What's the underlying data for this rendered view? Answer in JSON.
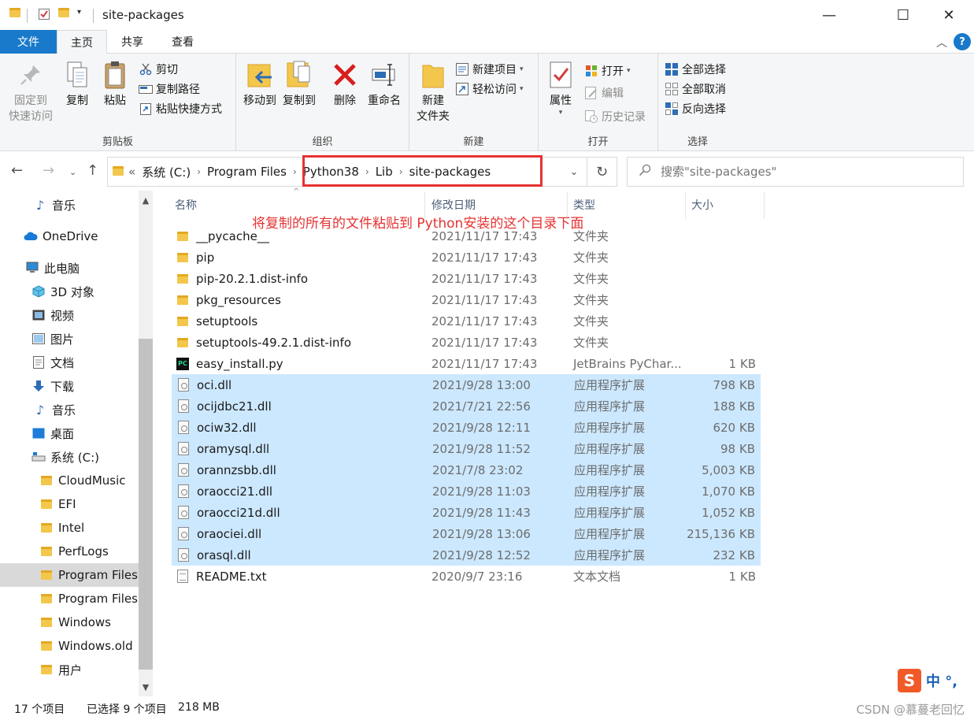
{
  "window": {
    "title": "site-packages",
    "minimize_glyph": "—",
    "maximize_glyph": "☐",
    "close_glyph": "✕"
  },
  "ribbon_tabs": [
    "文件",
    "主页",
    "共享",
    "查看"
  ],
  "ribbon": {
    "clipboard": {
      "group_label": "剪贴板",
      "pin_label_1": "固定到",
      "pin_label_2": "快速访问",
      "copy": "复制",
      "paste": "粘贴",
      "cut": "剪切",
      "copy_path": "复制路径",
      "paste_shortcut": "粘贴快捷方式"
    },
    "organize": {
      "group_label": "组织",
      "move_to": "移动到",
      "copy_to": "复制到",
      "delete": "删除",
      "rename": "重命名"
    },
    "new": {
      "group_label": "新建",
      "new_folder_1": "新建",
      "new_folder_2": "文件夹",
      "new_item": "新建项目",
      "easy_access": "轻松访问"
    },
    "open": {
      "group_label": "打开",
      "properties": "属性",
      "open": "打开",
      "edit": "编辑",
      "history": "历史记录"
    },
    "select": {
      "group_label": "选择",
      "select_all": "全部选择",
      "select_none": "全部取消",
      "invert": "反向选择"
    }
  },
  "address": {
    "overflow": "«",
    "crumbs": [
      "系统 (C:)",
      "Program Files",
      "Python38",
      "Lib",
      "site-packages"
    ]
  },
  "search": {
    "placeholder": "搜索\"site-packages\""
  },
  "sidebar": {
    "items": [
      {
        "label": "音乐",
        "icon": "music-icon"
      },
      {
        "label": "OneDrive",
        "icon": "cloud-icon"
      },
      {
        "label": "此电脑",
        "icon": "computer-icon"
      },
      {
        "label": "3D 对象",
        "icon": "cube-icon"
      },
      {
        "label": "视频",
        "icon": "video-icon"
      },
      {
        "label": "图片",
        "icon": "picture-icon"
      },
      {
        "label": "文档",
        "icon": "document-icon"
      },
      {
        "label": "下载",
        "icon": "download-icon"
      },
      {
        "label": "音乐",
        "icon": "music-icon"
      },
      {
        "label": "桌面",
        "icon": "desktop-icon"
      },
      {
        "label": "系统 (C:)",
        "icon": "drive-icon"
      },
      {
        "label": "CloudMusic",
        "icon": "folder-icon"
      },
      {
        "label": "EFI",
        "icon": "folder-icon"
      },
      {
        "label": "Intel",
        "icon": "folder-icon"
      },
      {
        "label": "PerfLogs",
        "icon": "folder-icon"
      },
      {
        "label": "Program Files",
        "icon": "folder-icon"
      },
      {
        "label": "Program Files",
        "icon": "folder-icon"
      },
      {
        "label": "Windows",
        "icon": "folder-icon"
      },
      {
        "label": "Windows.old",
        "icon": "folder-icon"
      },
      {
        "label": "用户",
        "icon": "folder-icon"
      }
    ]
  },
  "filelist": {
    "columns": {
      "name": "名称",
      "date": "修改日期",
      "type": "类型",
      "size": "大小"
    },
    "annotation": "将复制的所有的文件粘贴到 Python安装的这个目录下面",
    "rows": [
      {
        "name": "__pycache__",
        "date": "2021/11/17 17:43",
        "type": "文件夹",
        "size": "",
        "kind": "folder",
        "selected": false
      },
      {
        "name": "pip",
        "date": "2021/11/17 17:43",
        "type": "文件夹",
        "size": "",
        "kind": "folder",
        "selected": false
      },
      {
        "name": "pip-20.2.1.dist-info",
        "date": "2021/11/17 17:43",
        "type": "文件夹",
        "size": "",
        "kind": "folder",
        "selected": false
      },
      {
        "name": "pkg_resources",
        "date": "2021/11/17 17:43",
        "type": "文件夹",
        "size": "",
        "kind": "folder",
        "selected": false
      },
      {
        "name": "setuptools",
        "date": "2021/11/17 17:43",
        "type": "文件夹",
        "size": "",
        "kind": "folder",
        "selected": false
      },
      {
        "name": "setuptools-49.2.1.dist-info",
        "date": "2021/11/17 17:43",
        "type": "文件夹",
        "size": "",
        "kind": "folder",
        "selected": false
      },
      {
        "name": "easy_install.py",
        "date": "2021/11/17 17:43",
        "type": "JetBrains PyChar...",
        "size": "1 KB",
        "kind": "py",
        "selected": false
      },
      {
        "name": "oci.dll",
        "date": "2021/9/28 13:00",
        "type": "应用程序扩展",
        "size": "798 KB",
        "kind": "dll",
        "selected": true
      },
      {
        "name": "ocijdbc21.dll",
        "date": "2021/7/21 22:56",
        "type": "应用程序扩展",
        "size": "188 KB",
        "kind": "dll",
        "selected": true
      },
      {
        "name": "ociw32.dll",
        "date": "2021/9/28 12:11",
        "type": "应用程序扩展",
        "size": "620 KB",
        "kind": "dll",
        "selected": true
      },
      {
        "name": "oramysql.dll",
        "date": "2021/9/28 11:52",
        "type": "应用程序扩展",
        "size": "98 KB",
        "kind": "dll",
        "selected": true
      },
      {
        "name": "orannzsbb.dll",
        "date": "2021/7/8 23:02",
        "type": "应用程序扩展",
        "size": "5,003 KB",
        "kind": "dll",
        "selected": true
      },
      {
        "name": "oraocci21.dll",
        "date": "2021/9/28 11:03",
        "type": "应用程序扩展",
        "size": "1,070 KB",
        "kind": "dll",
        "selected": true
      },
      {
        "name": "oraocci21d.dll",
        "date": "2021/9/28 11:43",
        "type": "应用程序扩展",
        "size": "1,052 KB",
        "kind": "dll",
        "selected": true
      },
      {
        "name": "oraociei.dll",
        "date": "2021/9/28 13:06",
        "type": "应用程序扩展",
        "size": "215,136 KB",
        "kind": "dll",
        "selected": true
      },
      {
        "name": "orasql.dll",
        "date": "2021/9/28 12:52",
        "type": "应用程序扩展",
        "size": "232 KB",
        "kind": "dll",
        "selected": true
      },
      {
        "name": "README.txt",
        "date": "2020/9/7 23:16",
        "type": "文本文档",
        "size": "1 KB",
        "kind": "txt",
        "selected": false
      }
    ]
  },
  "status": {
    "count": "17 个项目",
    "selected": "已选择 9 个项目",
    "size": "218 MB"
  },
  "ime": {
    "logo": "S",
    "mode": "中 °,"
  },
  "watermark": "CSDN @慕蔓老回忆",
  "colors": {
    "accent": "#1979ca",
    "selection": "#cce8ff",
    "annotation": "#e63232",
    "folder": "#f3c64c"
  }
}
